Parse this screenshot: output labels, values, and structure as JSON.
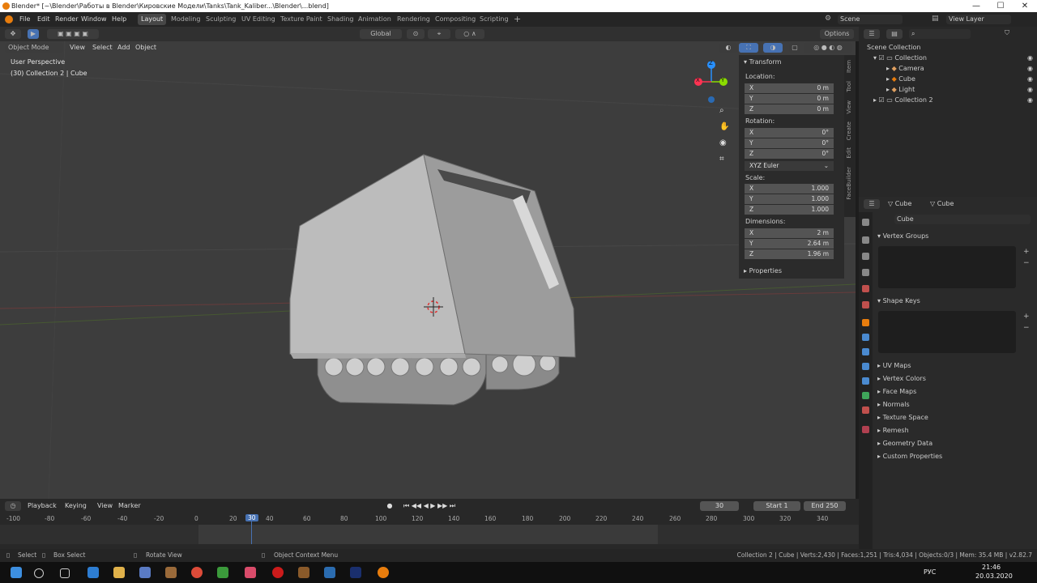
{
  "window": {
    "title": "Blender* [~\\Blender\\Работы в Blender\\Кировские Модели\\Tanks\\Tank_Kaliber...\\Blender\\...blend]",
    "controls": [
      "—",
      "☐",
      "✕"
    ]
  },
  "menu": [
    "File",
    "Edit",
    "Render",
    "Window",
    "Help"
  ],
  "workspaces": [
    "Layout",
    "Modeling",
    "Sculpting",
    "UV Editing",
    "Texture Paint",
    "Shading",
    "Animation",
    "Rendering",
    "Compositing",
    "Scripting"
  ],
  "workspace_add": "+",
  "scene": {
    "label": "Scene",
    "view_layer": "View Layer"
  },
  "toolbar": {
    "transform_orientation": "Global",
    "options": "Options"
  },
  "viewport_header": {
    "mode": "Object Mode",
    "menus": [
      "View",
      "Select",
      "Add",
      "Object"
    ]
  },
  "viewport": {
    "perspective": "User Perspective",
    "collection_info": "(30) Collection 2 | Cube",
    "gizmo_axes": {
      "x": "X",
      "y": "Y",
      "z": "Z"
    }
  },
  "npanel": {
    "header": "Transform",
    "location_label": "Location:",
    "location": [
      {
        "axis": "X",
        "value": "0 m"
      },
      {
        "axis": "Y",
        "value": "0 m"
      },
      {
        "axis": "Z",
        "value": "0 m"
      }
    ],
    "rotation_label": "Rotation:",
    "rotation": [
      {
        "axis": "X",
        "value": "0°"
      },
      {
        "axis": "Y",
        "value": "0°"
      },
      {
        "axis": "Z",
        "value": "0°"
      }
    ],
    "rotation_mode": "XYZ Euler",
    "scale_label": "Scale:",
    "scale": [
      {
        "axis": "X",
        "value": "1.000"
      },
      {
        "axis": "Y",
        "value": "1.000"
      },
      {
        "axis": "Z",
        "value": "1.000"
      }
    ],
    "dimensions_label": "Dimensions:",
    "dimensions": [
      {
        "axis": "X",
        "value": "2 m"
      },
      {
        "axis": "Y",
        "value": "2.64 m"
      },
      {
        "axis": "Z",
        "value": "1.96 m"
      }
    ],
    "properties": "Properties",
    "tabs": [
      "Item",
      "Tool",
      "View",
      "Create",
      "Edit",
      "FaceBuilder"
    ]
  },
  "outliner": {
    "root": "Scene Collection",
    "items": [
      {
        "label": "Collection",
        "level": 1
      },
      {
        "label": "Camera",
        "level": 2
      },
      {
        "label": "Cube",
        "level": 2
      },
      {
        "label": "Light",
        "level": 2
      },
      {
        "label": "Collection 2",
        "level": 1
      }
    ]
  },
  "properties": {
    "object_name": "Cube",
    "data_name": "Cube",
    "mesh_field": "Cube",
    "sections_open": [
      "Vertex Groups",
      "Shape Keys"
    ],
    "sections": [
      "UV Maps",
      "Vertex Colors",
      "Face Maps",
      "Normals",
      "Texture Space",
      "Remesh",
      "Geometry Data",
      "Custom Properties"
    ]
  },
  "timeline": {
    "menus": [
      "Playback",
      "Keying",
      "View",
      "Marker"
    ],
    "current_frame": "30",
    "start_label": "Start",
    "start": "1",
    "end_label": "End",
    "end": "250",
    "frame_marks": [
      "-100",
      "-80",
      "-60",
      "-40",
      "-20",
      "0",
      "20",
      "30",
      "40",
      "60",
      "80",
      "100",
      "120",
      "140",
      "160",
      "180",
      "200",
      "220",
      "240",
      "260",
      "280",
      "300",
      "320",
      "340"
    ]
  },
  "status": {
    "select": "Select",
    "box_select": "Box Select",
    "rotate": "Rotate View",
    "context": "Object Context Menu",
    "stats": "Collection 2 | Cube | Verts:2,430 | Faces:1,251 | Tris:4,034 | Objects:0/3 | Mem: 35.4 MB | v2.82.7"
  },
  "taskbar": {
    "time": "21:46",
    "date": "20.03.2020",
    "lang": "РУС"
  },
  "colors": {
    "accent": "#4772b3",
    "active_orange": "#e87d0d",
    "x_axis": "#ff3352",
    "y_axis": "#8bdc00",
    "z_axis": "#2890ff"
  }
}
